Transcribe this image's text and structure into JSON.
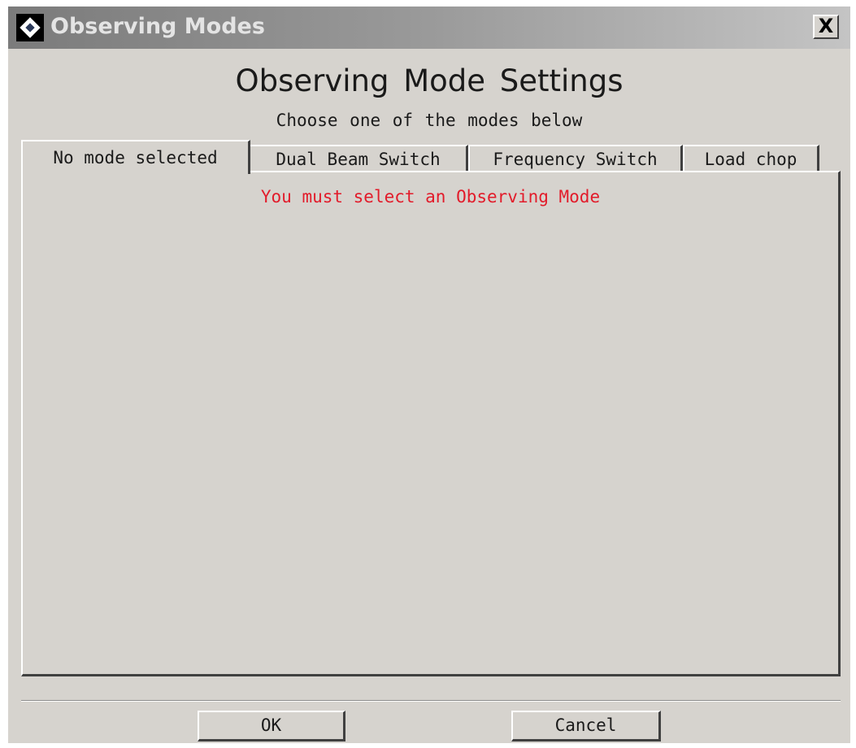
{
  "window": {
    "title": "Observing Modes",
    "close_label": "X"
  },
  "dialog": {
    "heading": "Observing Mode Settings",
    "subheading": "Choose one of the modes below"
  },
  "tabs": [
    {
      "label": "No mode selected",
      "selected": true
    },
    {
      "label": "Dual Beam Switch",
      "selected": false
    },
    {
      "label": "Frequency Switch",
      "selected": false
    },
    {
      "label": "Load chop",
      "selected": false
    }
  ],
  "panel": {
    "message": "You must select an Observing Mode"
  },
  "buttons": {
    "ok_label": "OK",
    "cancel_label": "Cancel"
  },
  "colors": {
    "window_bg": "#d6d3ce",
    "warning_text": "#e21b2a",
    "title_text": "#e4e4e4"
  },
  "icons": {
    "app": "app-logo-icon",
    "close": "close-icon"
  }
}
